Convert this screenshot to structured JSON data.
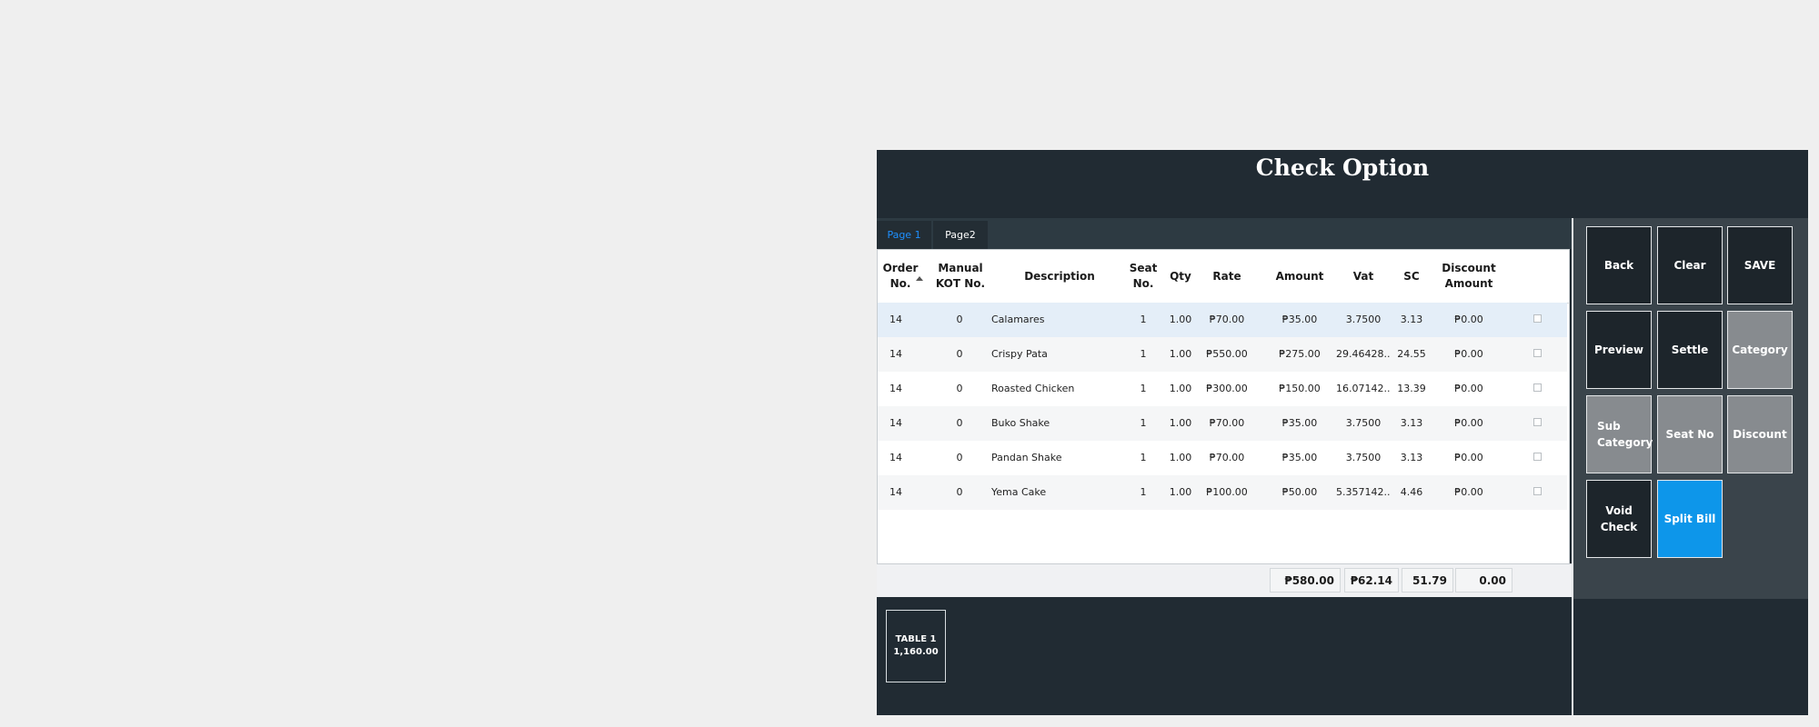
{
  "dialog": {
    "title": "Check Option"
  },
  "tabs": [
    {
      "label": "Page 1",
      "active": true
    },
    {
      "label": "Page2",
      "active": false
    }
  ],
  "grid": {
    "columns": [
      {
        "key": "order_no",
        "label": "Order\nNo."
      },
      {
        "key": "manual_kot_no",
        "label": "Manual\nKOT No."
      },
      {
        "key": "description",
        "label": "Description"
      },
      {
        "key": "seat_no",
        "label": "Seat\nNo."
      },
      {
        "key": "qty",
        "label": "Qty"
      },
      {
        "key": "rate",
        "label": "Rate"
      },
      {
        "key": "amount",
        "label": "Amount"
      },
      {
        "key": "vat",
        "label": "Vat"
      },
      {
        "key": "sc",
        "label": "SC"
      },
      {
        "key": "discount_amount",
        "label": "Discount\nAmount"
      }
    ],
    "rows": [
      {
        "order_no": "14",
        "manual_kot_no": "0",
        "description": "Calamares",
        "seat_no": "1",
        "qty": "1.00",
        "rate": "₱70.00",
        "amount": "₱35.00",
        "vat": "3.7500",
        "sc": "3.13",
        "discount_amount": "₱0.00",
        "checked": false
      },
      {
        "order_no": "14",
        "manual_kot_no": "0",
        "description": "Crispy Pata",
        "seat_no": "1",
        "qty": "1.00",
        "rate": "₱550.00",
        "amount": "₱275.00",
        "vat": "29.46428...",
        "sc": "24.55",
        "discount_amount": "₱0.00",
        "checked": false
      },
      {
        "order_no": "14",
        "manual_kot_no": "0",
        "description": "Roasted Chicken",
        "seat_no": "1",
        "qty": "1.00",
        "rate": "₱300.00",
        "amount": "₱150.00",
        "vat": "16.07142...",
        "sc": "13.39",
        "discount_amount": "₱0.00",
        "checked": false
      },
      {
        "order_no": "14",
        "manual_kot_no": "0",
        "description": "Buko Shake",
        "seat_no": "1",
        "qty": "1.00",
        "rate": "₱70.00",
        "amount": "₱35.00",
        "vat": "3.7500",
        "sc": "3.13",
        "discount_amount": "₱0.00",
        "checked": false
      },
      {
        "order_no": "14",
        "manual_kot_no": "0",
        "description": "Pandan Shake",
        "seat_no": "1",
        "qty": "1.00",
        "rate": "₱70.00",
        "amount": "₱35.00",
        "vat": "3.7500",
        "sc": "3.13",
        "discount_amount": "₱0.00",
        "checked": false
      },
      {
        "order_no": "14",
        "manual_kot_no": "0",
        "description": "Yema Cake",
        "seat_no": "1",
        "qty": "1.00",
        "rate": "₱100.00",
        "amount": "₱50.00",
        "vat": "5.357142...",
        "sc": "4.46",
        "discount_amount": "₱0.00",
        "checked": false
      }
    ],
    "totals": {
      "amount": "₱580.00",
      "vat": "₱62.14",
      "sc": "51.79",
      "discount": "0.00"
    }
  },
  "table_tile": {
    "name": "TABLE 1",
    "total": "1,160.00"
  },
  "buttons": {
    "back": "Back",
    "clear": "Clear",
    "save": "SAVE",
    "preview": "Preview",
    "settle": "Settle",
    "category": "Category",
    "sub_category": "Sub\nCategory",
    "seat_no": "Seat No",
    "discount": "Discount",
    "void_check": "Void\nCheck",
    "split_bill": "Split Bill"
  },
  "colors": {
    "dialog_bg": "#212b33",
    "button_dark": "#1d252b",
    "button_gray": "#878b8f",
    "button_blue": "#0d96ea",
    "active_tab_text": "#1e90ff",
    "selected_row": "#e4eef8"
  }
}
